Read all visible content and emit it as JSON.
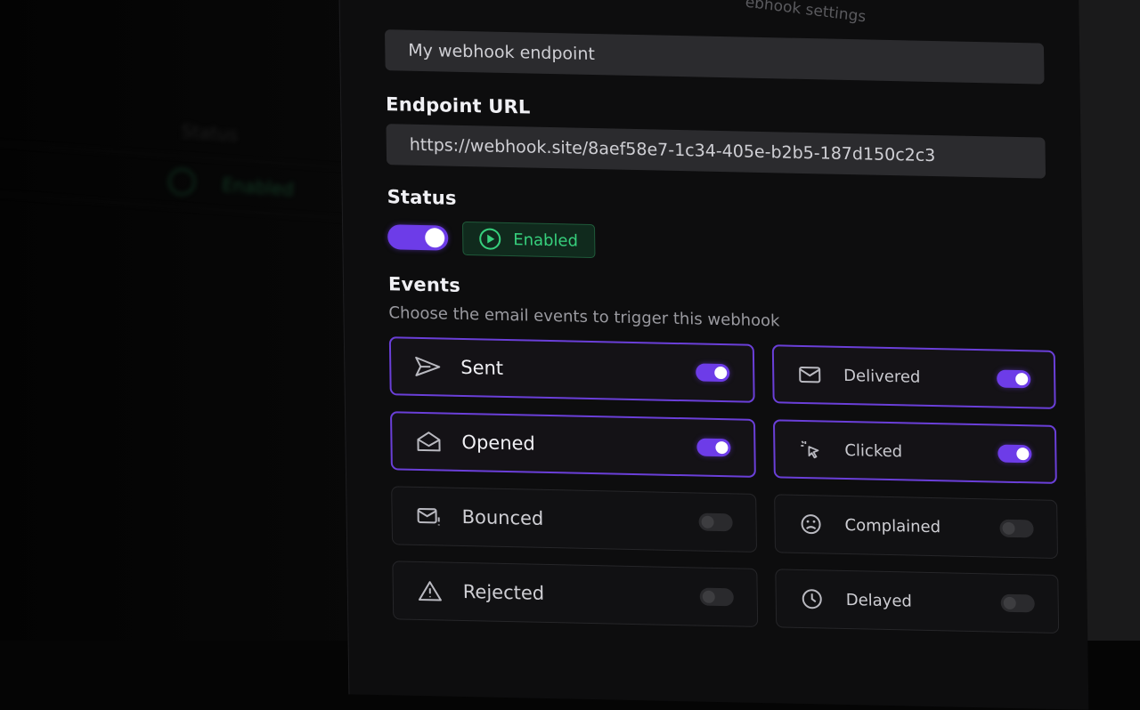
{
  "background": {
    "table_header": "Status",
    "table_status": "Enabled"
  },
  "header_hint": "ebhook settings",
  "name_field": {
    "value": "My webhook endpoint"
  },
  "endpoint": {
    "label": "Endpoint URL",
    "value": "https://webhook.site/8aef58e7-1c34-405e-b2b5-187d150c2c3"
  },
  "status": {
    "label": "Status",
    "toggle_on": true,
    "badge": "Enabled"
  },
  "events": {
    "label": "Events",
    "description": "Choose the email events to trigger this webhook",
    "items": [
      {
        "name": "Sent",
        "icon": "send-icon",
        "enabled": true
      },
      {
        "name": "Delivered",
        "icon": "mail-check-icon",
        "enabled": true
      },
      {
        "name": "Opened",
        "icon": "mail-open-icon",
        "enabled": true
      },
      {
        "name": "Clicked",
        "icon": "cursor-click-icon",
        "enabled": true
      },
      {
        "name": "Bounced",
        "icon": "mail-warning-icon",
        "enabled": false
      },
      {
        "name": "Complained",
        "icon": "frown-icon",
        "enabled": false
      },
      {
        "name": "Rejected",
        "icon": "alert-triangle-icon",
        "enabled": false
      },
      {
        "name": "Delayed",
        "icon": "clock-icon",
        "enabled": false
      }
    ]
  },
  "colors": {
    "accent": "#6d3ce8",
    "success": "#37d07d",
    "panel": "#0d0d0e",
    "field": "#2b2b2e"
  }
}
